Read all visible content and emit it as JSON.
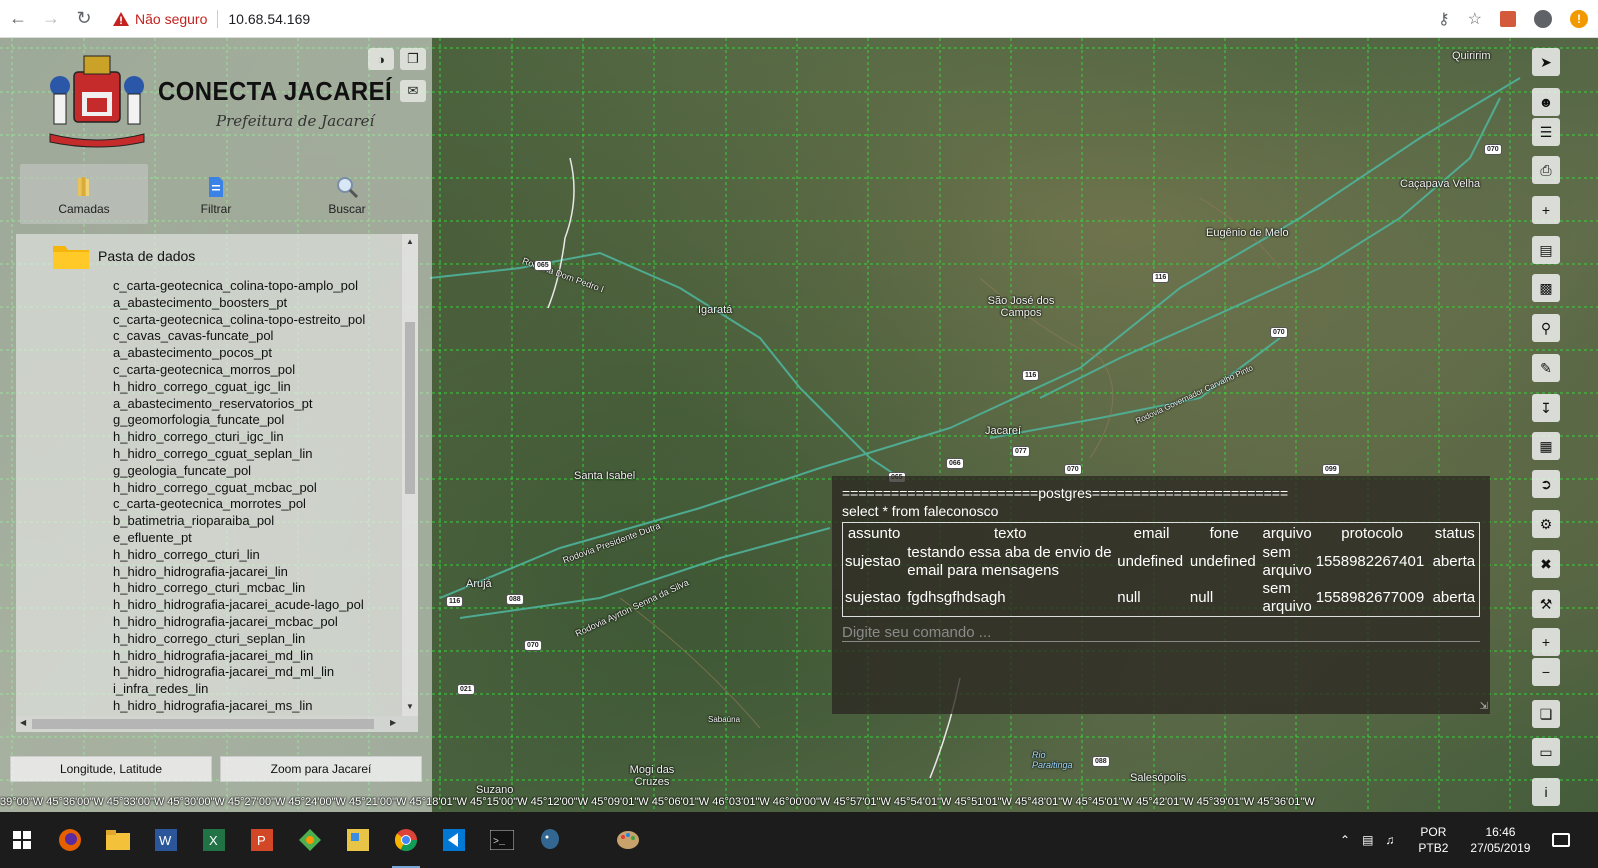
{
  "browser": {
    "security_label": "Não seguro",
    "url": "10.68.54.169"
  },
  "app": {
    "title": "CONECTA JACAREÍ",
    "subtitle": "Prefeitura de Jacareí",
    "buttons": {
      "camadas": "Camadas",
      "filtrar": "Filtrar",
      "buscar": "Buscar"
    },
    "folder_label": "Pasta de dados",
    "layers": [
      "c_carta-geotecnica_colina-topo-amplo_pol",
      "a_abastecimento_boosters_pt",
      "c_carta-geotecnica_colina-topo-estreito_pol",
      "c_cavas_cavas-funcate_pol",
      "a_abastecimento_pocos_pt",
      "c_carta-geotecnica_morros_pol",
      "h_hidro_corrego_cguat_igc_lin",
      "a_abastecimento_reservatorios_pt",
      "g_geomorfologia_funcate_pol",
      "h_hidro_corrego_cturi_igc_lin",
      "h_hidro_corrego_cguat_seplan_lin",
      "g_geologia_funcate_pol",
      "h_hidro_corrego_cguat_mcbac_pol",
      "c_carta-geotecnica_morrotes_pol",
      "b_batimetria_rioparaiba_pol",
      "e_efluente_pt",
      "h_hidro_corrego_cturi_lin",
      "h_hidro_hidrografia-jacarei_lin",
      "h_hidro_corrego_cturi_mcbac_lin",
      "h_hidro_hidrografia-jacarei_acude-lago_pol",
      "h_hidro_hidrografia-jacarei_mcbac_pol",
      "h_hidro_corrego_cturi_seplan_lin",
      "h_hidro_hidrografia-jacarei_md_lin",
      "h_hidro_hidrografia-jacarei_md_ml_lin",
      "i_infra_redes_lin",
      "h_hidro_hidrografia-jacarei_ms_lin"
    ],
    "bottom_buttons": {
      "lonlat": "Longitude, Latitude",
      "zoom": "Zoom para Jacareí"
    }
  },
  "console": {
    "header": "========================postgres========================",
    "query": "select * from faleconosco",
    "columns": [
      "assunto",
      "texto",
      "email",
      "fone",
      "arquivo",
      "protocolo",
      "status"
    ],
    "rows": [
      [
        "sujestao",
        "testando essa aba de envio de email para mensagens",
        "undefined",
        "undefined",
        "sem arquivo",
        "1558982267401",
        "aberta"
      ],
      [
        "sujestao",
        "fgdhsgfhdsagh",
        "null",
        "null",
        "sem arquivo",
        "1558982677009",
        "aberta"
      ]
    ],
    "input_placeholder": "Digite seu comando ..."
  },
  "map": {
    "places": [
      {
        "name": "Quiririm"
      },
      {
        "name": "Caçapava Velha"
      },
      {
        "name": "Eugênio de Melo"
      },
      {
        "name": "São José dos Campos"
      },
      {
        "name": "Igaratá"
      },
      {
        "name": "Jacareí"
      },
      {
        "name": "Santa Isabel"
      },
      {
        "name": "Arujá"
      },
      {
        "name": "Mogi das Cruzes"
      },
      {
        "name": "Suzano"
      },
      {
        "name": "Salesópolis"
      },
      {
        "name": "Sabaúna"
      },
      {
        "name": "Rio Paraitinga"
      },
      {
        "name": "Rodovia Dom Pedro I"
      },
      {
        "name": "Rodovia Presidente Dutra"
      },
      {
        "name": "Rodovia Ayrton Senna da Silva"
      },
      {
        "name": "Rodovia Governador Carvalho Pinto"
      }
    ],
    "coord_strip": "39°00\"W  45°36'00\"W  45°33'00\"W  45°30'00\"W  45°27'00\"W  45°24'00\"W  45°21'00\"W  45°18'01\"W  45°15'00\"W  45°12'00\"W  45°09'01\"W  45°06'01\"W  46°03'01\"W  46°00'00\"W  45°57'01\"W  45°54'01\"W  45°51'01\"W  45°48'01\"W  45°45'01\"W  45°42'01\"W  45°39'01\"W  45°36'01\"W"
  },
  "taskbar": {
    "lang_top": "POR",
    "lang_bottom": "PTB2",
    "time": "16:46",
    "date": "27/05/2019"
  }
}
